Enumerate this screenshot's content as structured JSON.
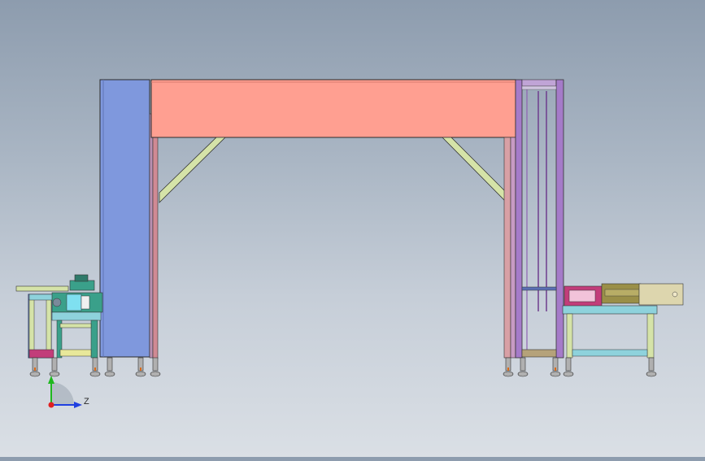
{
  "triad": {
    "z_label": "Z"
  },
  "colors": {
    "beam": "#ff9f91",
    "left_column": "#7f98dd",
    "brace": "#d5e3a8",
    "frame_pink": "#d8a0a5",
    "frame_purple": "#a57bc9",
    "table_teal": "#8ed2dc",
    "table_yellow": "#e8e89a",
    "motor_teal": "#3aa08a",
    "housing_magenta": "#c23d7a",
    "module_olive": "#9a8f48",
    "tan_block": "#ddd6ae"
  }
}
